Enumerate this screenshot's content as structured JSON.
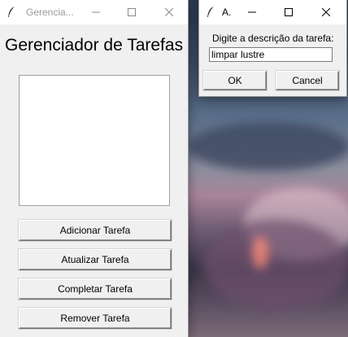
{
  "main_window": {
    "title": "Gerencia...",
    "heading": "Gerenciador de Tarefas",
    "task_list_items": [],
    "buttons": {
      "add": "Adicionar Tarefa",
      "update": "Atualizar Tarefa",
      "complete": "Completar Tarefa",
      "remove": "Remover Tarefa"
    }
  },
  "dialog": {
    "title": "A.",
    "prompt": "Digite a descrição da tarefa:",
    "input_value": "limpar lustre",
    "ok_label": "OK",
    "cancel_label": "Cancel"
  },
  "icons": {
    "app": "feather-icon",
    "minimize": "minimize-icon",
    "maximize": "maximize-icon",
    "close": "close-icon"
  }
}
